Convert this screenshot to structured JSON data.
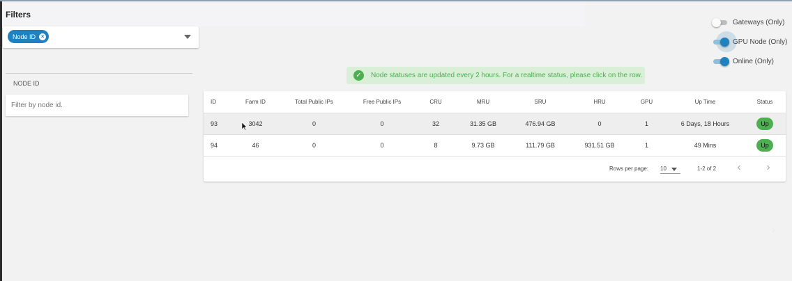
{
  "filters": {
    "title": "Filters",
    "selected_chip": "Node ID",
    "section_label": "NODE ID",
    "input_placeholder": "Filter by node id."
  },
  "toggles": [
    {
      "label": "Gateways (Only)",
      "on": false
    },
    {
      "label": "GPU Node (Only)",
      "on": true
    },
    {
      "label": "Online (Only)",
      "on": true
    }
  ],
  "alert": {
    "icon": "check-circle-icon",
    "text": "Node statuses are updated every 2 hours. For a realtime status, please click on the row."
  },
  "table": {
    "columns": [
      "ID",
      "Farm ID",
      "Total Public IPs",
      "Free Public IPs",
      "CRU",
      "MRU",
      "SRU",
      "HRU",
      "GPU",
      "Up Time",
      "Status"
    ],
    "rows": [
      [
        "93",
        "3042",
        "0",
        "0",
        "32",
        "31.35 GB",
        "476.94 GB",
        "0",
        "1",
        "6 Days, 18 Hours",
        "Up"
      ],
      [
        "94",
        "46",
        "0",
        "0",
        "8",
        "9.73 GB",
        "111.79 GB",
        "931.51 GB",
        "1",
        "49 Mins",
        "Up"
      ]
    ]
  },
  "pagination": {
    "rows_per_page_label": "Rows per page:",
    "rows_per_page": "10",
    "range": "1-2 of 2"
  },
  "colors": {
    "accent": "#1f82bf",
    "success": "#4caf50",
    "alert_bg": "#d9efd8"
  }
}
